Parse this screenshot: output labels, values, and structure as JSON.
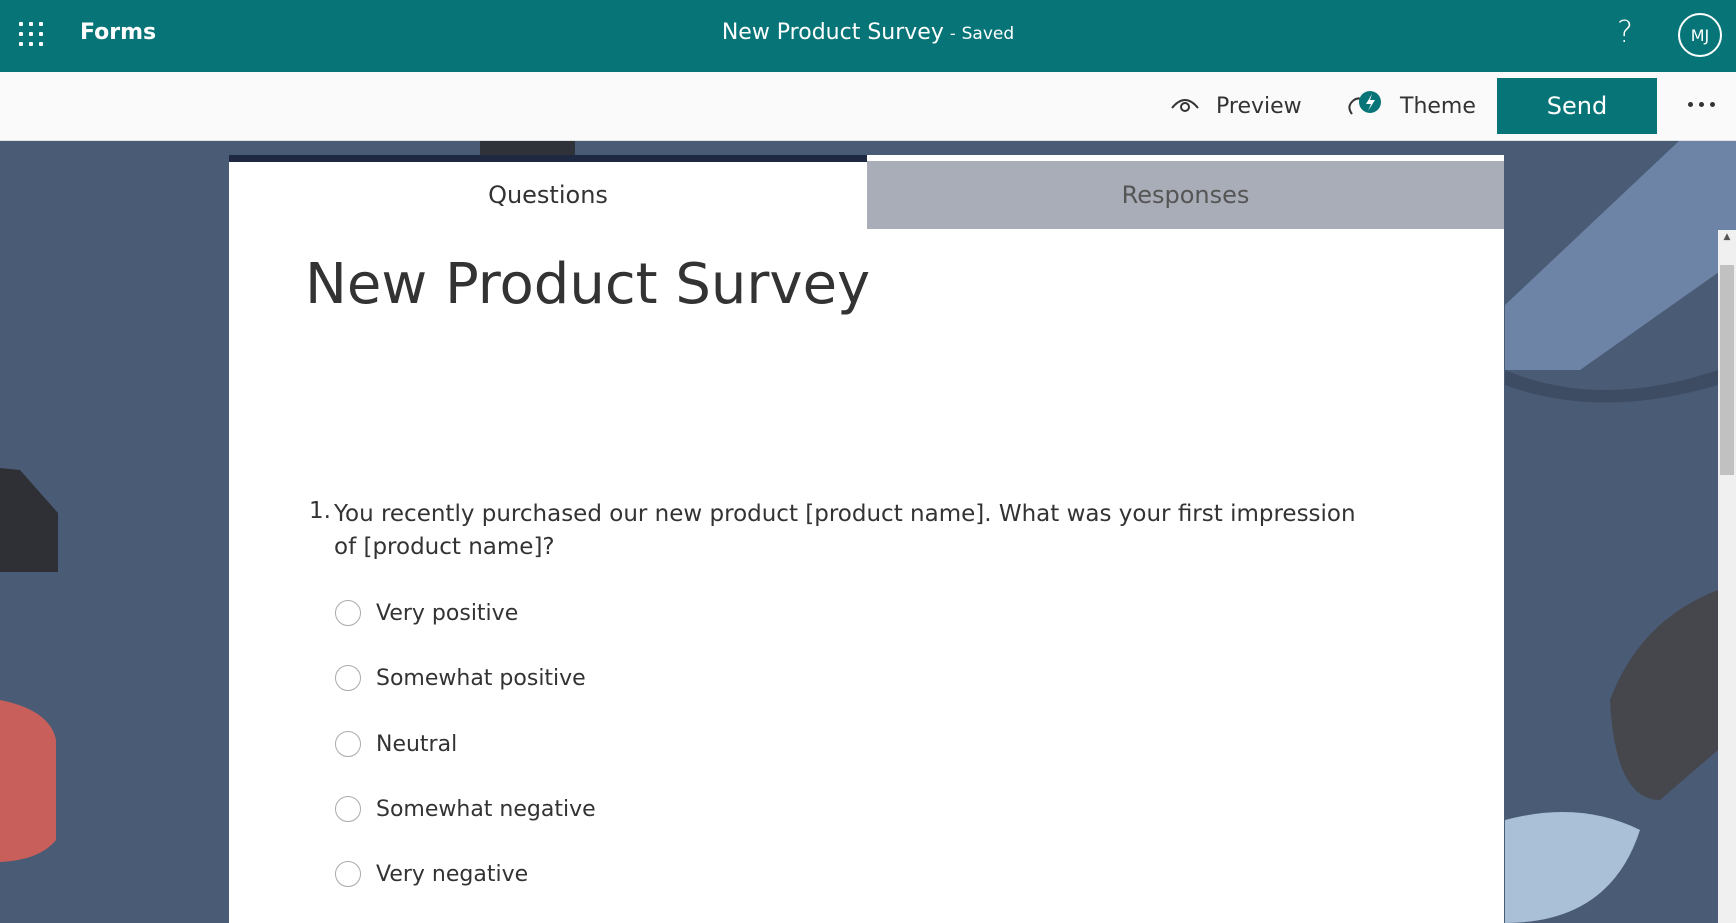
{
  "appbar": {
    "app_name": "Forms",
    "doc_title": "New Product Survey",
    "separator": "-",
    "status": "Saved",
    "help": "?",
    "avatar_initials": "MJ"
  },
  "commands": {
    "preview": "Preview",
    "theme": "Theme",
    "send": "Send"
  },
  "tabs": [
    {
      "label": "Questions",
      "active": true
    },
    {
      "label": "Responses",
      "active": false
    }
  ],
  "form": {
    "title": "New Product Survey",
    "questions": [
      {
        "number": "1.",
        "text": "You recently purchased our new product [product name]. What was your first impression of [product name]?",
        "options": [
          "Very positive",
          "Somewhat positive",
          "Neutral",
          "Somewhat negative",
          "Very negative"
        ]
      }
    ]
  },
  "colors": {
    "brand": "#077578",
    "background": "#4a5b75",
    "tab_inactive": "#a8adb8"
  }
}
